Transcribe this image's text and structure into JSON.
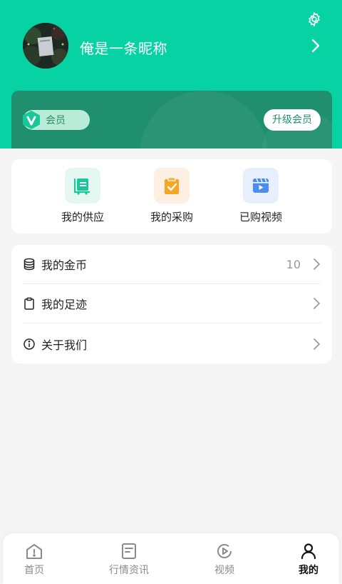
{
  "colors": {
    "brand": "#07d2a4",
    "member_card": "#1f8f6d",
    "supply_icon": "#19c79a",
    "purchase_icon": "#f5a623",
    "video_icon": "#4a8cf0"
  },
  "profile": {
    "username": "俺是一条昵称",
    "avatar": "avatar-photo",
    "settings_icon": "gear-icon",
    "chevron_icon": "chevron-right-icon"
  },
  "member": {
    "badge_label": "会员",
    "upgrade_label": "升级会员"
  },
  "quick_actions": [
    {
      "label": "我的供应",
      "icon": "supply-icon"
    },
    {
      "label": "我的采购",
      "icon": "purchase-clipboard-icon"
    },
    {
      "label": "已购视频",
      "icon": "video-icon"
    }
  ],
  "menu": [
    {
      "label": "我的金币",
      "value": "10",
      "icon": "coins-icon"
    },
    {
      "label": "我的足迹",
      "value": "",
      "icon": "clipboard-icon"
    },
    {
      "label": "关于我们",
      "value": "",
      "icon": "info-icon"
    }
  ],
  "tabs": [
    {
      "label": "首页",
      "icon": "home-icon",
      "active": false
    },
    {
      "label": "行情资讯",
      "icon": "news-icon",
      "active": false
    },
    {
      "label": "视频",
      "icon": "play-icon",
      "active": false
    },
    {
      "label": "我的",
      "icon": "user-icon",
      "active": true
    }
  ]
}
